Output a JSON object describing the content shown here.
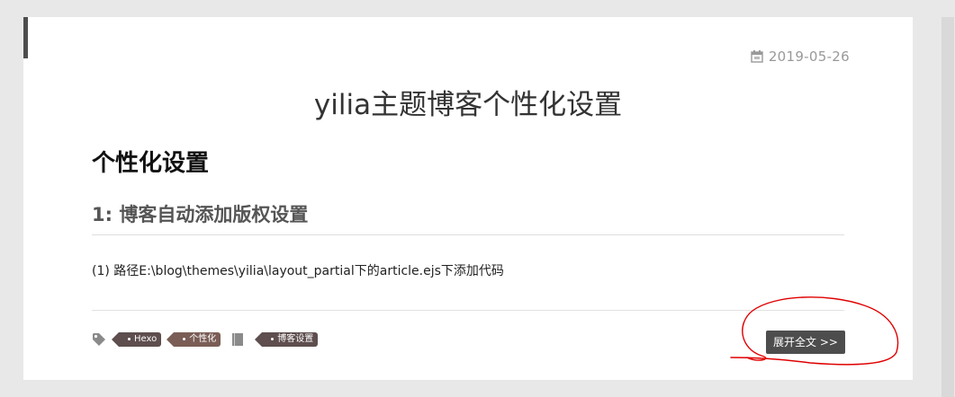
{
  "post": {
    "date": "2019-05-26",
    "title": "yilia主题博客个性化设置",
    "heading1": "个性化设置",
    "heading2": "1: 博客自动添加版权设置",
    "paragraph": "(1) 路径E:\\blog\\themes\\yilia\\layout_partial下的article.ejs下添加代码"
  },
  "tags": [
    "Hexo",
    "个性化"
  ],
  "categories": [
    "博客设置"
  ],
  "read_more_label": "展开全文 >>",
  "colors": {
    "accent": "#4d4d4d",
    "tag": "#5e4e4e",
    "annotation": "#e00000"
  },
  "icons": {
    "date": "calendar-icon",
    "tags": "tag-icon",
    "category": "book-icon"
  }
}
